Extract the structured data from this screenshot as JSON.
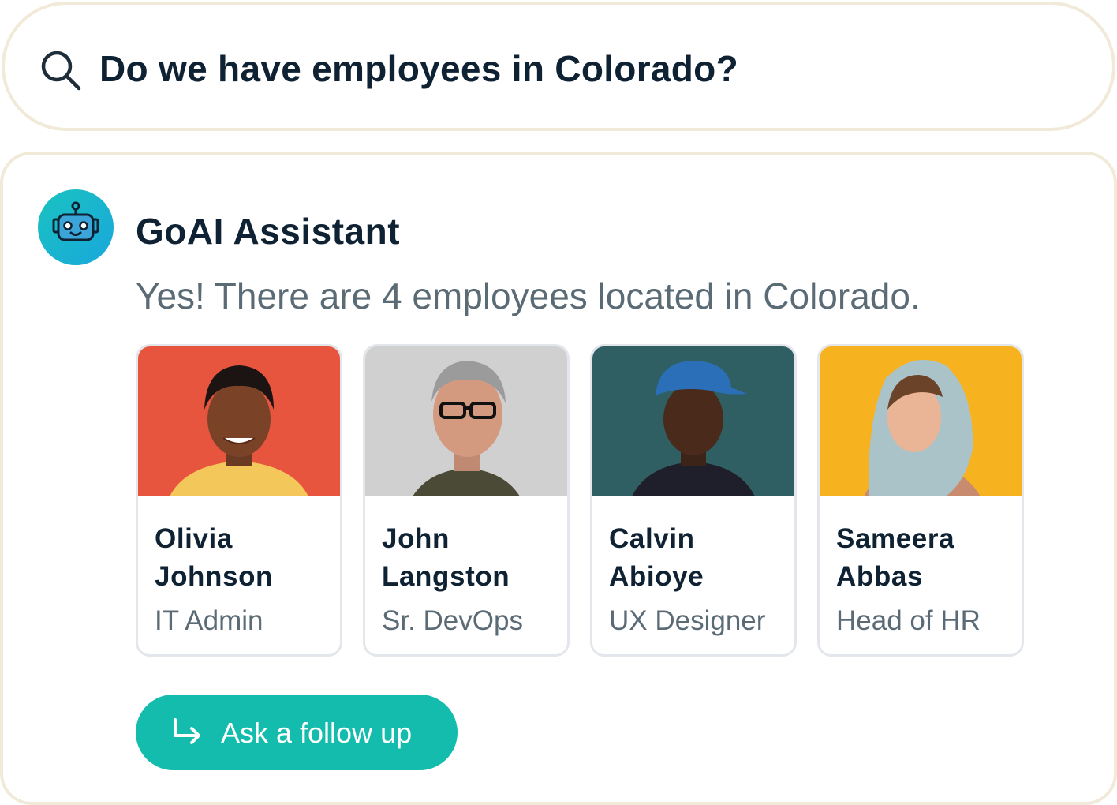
{
  "search": {
    "icon": "search-icon",
    "query": "Do we have employees in Colorado?"
  },
  "assistant": {
    "avatar_icon": "robot-icon",
    "name": "GoAI Assistant",
    "message": "Yes! There are 4 employees located in Colorado."
  },
  "employees": [
    {
      "first_name": "Olivia",
      "last_name": "Johnson",
      "role": "IT Admin",
      "photo_bg": "#e8553e"
    },
    {
      "first_name": "John",
      "last_name": "Langston",
      "role": "Sr. DevOps",
      "photo_bg": "#cfcfcf"
    },
    {
      "first_name": "Calvin",
      "last_name": "Abioye",
      "role": "UX Designer",
      "photo_bg": "#2f5f63"
    },
    {
      "first_name": "Sameera",
      "last_name": "Abbas",
      "role": "Head of HR",
      "photo_bg": "#f6b21f"
    }
  ],
  "followup": {
    "icon": "arrow-return-icon",
    "label": "Ask a follow up"
  },
  "colors": {
    "accent": "#13bcac",
    "border": "#f1ead9",
    "text_dark": "#0f2233",
    "text_muted": "#5b6b76"
  }
}
